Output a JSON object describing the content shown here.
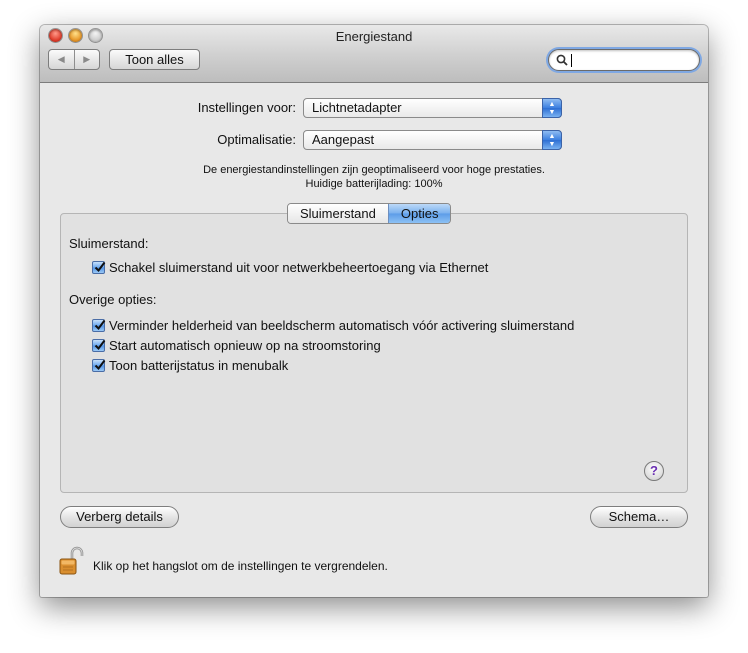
{
  "window": {
    "title": "Energiestand"
  },
  "toolbar": {
    "back_icon": "back-arrow-icon",
    "forward_icon": "forward-arrow-icon",
    "show_all_label": "Toon alles",
    "search_value": "",
    "search_placeholder": ""
  },
  "settings": {
    "settings_for_label": "Instellingen voor:",
    "settings_for_value": "Lichtnetadapter",
    "optimization_label": "Optimalisatie:",
    "optimization_value": "Aangepast",
    "info_line1": "De energiestandinstellingen zijn geoptimaliseerd voor hoge prestaties.",
    "info_line2": "Huidige batterijlading: 100%"
  },
  "tabs": [
    {
      "label": "Sluimerstand",
      "selected": false
    },
    {
      "label": "Opties",
      "selected": true
    }
  ],
  "options": {
    "sleep_section_label": "Sluimerstand:",
    "sleep_items": [
      {
        "label": "Schakel sluimerstand uit voor netwerkbeheertoegang via Ethernet",
        "checked": true
      }
    ],
    "other_section_label": "Overige opties:",
    "other_items": [
      {
        "label": "Verminder helderheid van beeldscherm automatisch vóór activering sluimerstand",
        "checked": true
      },
      {
        "label": "Start automatisch opnieuw op na stroomstoring",
        "checked": true
      },
      {
        "label": "Toon batterijstatus in menubalk",
        "checked": true
      }
    ],
    "help_label": "?"
  },
  "footer": {
    "hide_details_label": "Verberg details",
    "schedule_label": "Schema…",
    "lock_text": "Klik op het hangslot om de instellingen te vergrendelen."
  },
  "colors": {
    "accent_blue": "#5c9ce8",
    "window_bg": "#e8e8e8",
    "help_purple": "#6a2fb2"
  }
}
